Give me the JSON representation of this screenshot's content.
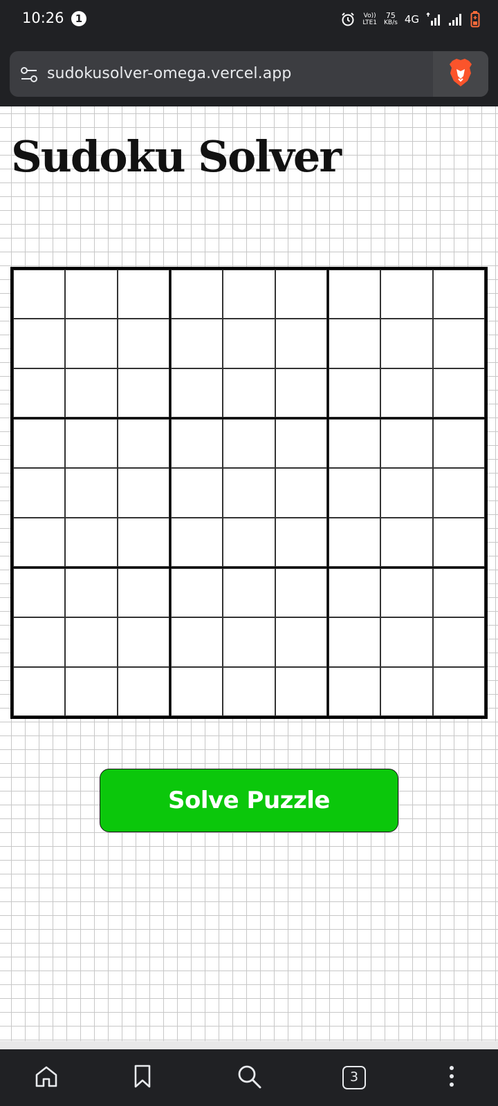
{
  "status_bar": {
    "time": "10:26",
    "notification_count": "1",
    "volte_top": "Vo))",
    "volte_bottom": "LTE1",
    "speed_value": "75",
    "speed_unit": "KB/s",
    "network": "4G"
  },
  "browser": {
    "url": "sudokusolver-omega.vercel.app",
    "tab_count": "3"
  },
  "page": {
    "title": "Sudoku Solver",
    "solve_label": "Solve Puzzle",
    "board": [
      [
        "",
        "",
        "",
        "",
        "",
        "",
        "",
        "",
        ""
      ],
      [
        "",
        "",
        "",
        "",
        "",
        "",
        "",
        "",
        ""
      ],
      [
        "",
        "",
        "",
        "",
        "",
        "",
        "",
        "",
        ""
      ],
      [
        "",
        "",
        "",
        "",
        "",
        "",
        "",
        "",
        ""
      ],
      [
        "",
        "",
        "",
        "",
        "",
        "",
        "",
        "",
        ""
      ],
      [
        "",
        "",
        "",
        "",
        "",
        "",
        "",
        "",
        ""
      ],
      [
        "",
        "",
        "",
        "",
        "",
        "",
        "",
        "",
        ""
      ],
      [
        "",
        "",
        "",
        "",
        "",
        "",
        "",
        "",
        ""
      ],
      [
        "",
        "",
        "",
        "",
        "",
        "",
        "",
        "",
        ""
      ]
    ]
  },
  "colors": {
    "solve_button": "#0bc70b",
    "chrome_dark": "#202124",
    "url_bar": "#3c3d41",
    "brave_orange": "#fb542b"
  },
  "icons": {
    "status": [
      "alarm-icon",
      "signal-icon",
      "battery-icon"
    ],
    "url_bar": [
      "site-settings-icon",
      "brave-lion-icon"
    ],
    "bottom_nav": [
      "home-icon",
      "bookmark-icon",
      "search-icon",
      "tabs-icon",
      "menu-icon"
    ]
  }
}
